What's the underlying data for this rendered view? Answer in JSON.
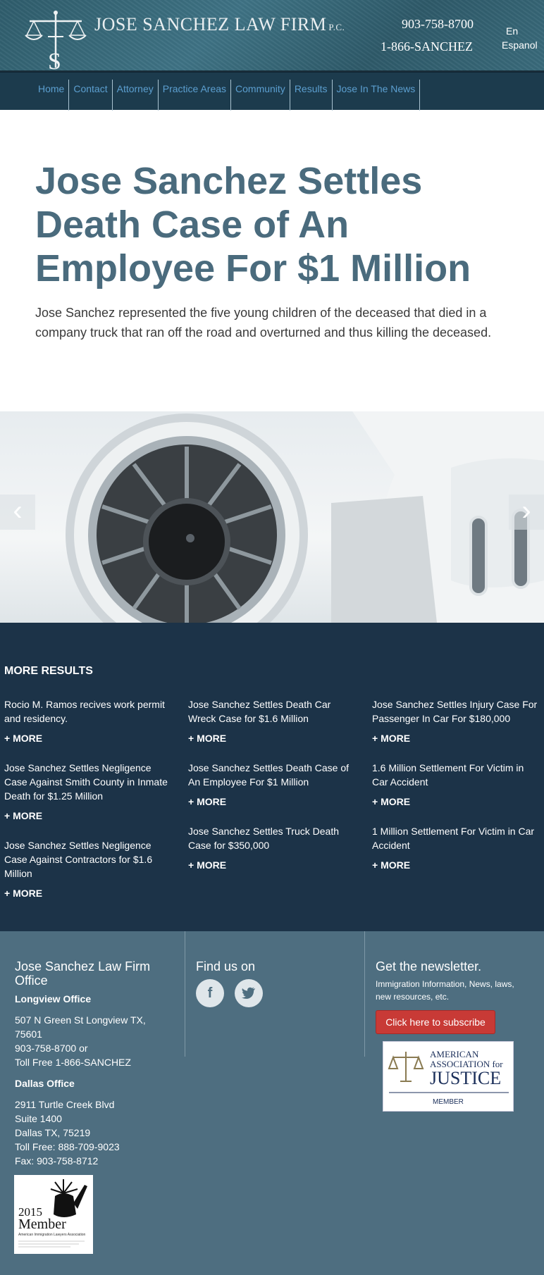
{
  "header": {
    "firm_name": "JOSE SANCHEZ LAW FIRM",
    "firm_suffix": "P.C.",
    "logo_letter": "S",
    "phone_1": "903-758-8700",
    "phone_2": "1-866-SANCHEZ",
    "lang_en": "En",
    "lang_es": "Espanol"
  },
  "nav": {
    "items": [
      "Home",
      "Contact",
      "Attorney",
      "Practice Areas",
      "Community",
      "Results",
      "Jose In The News"
    ]
  },
  "hero": {
    "title": "Jose Sanchez Settles Death Case of An Employee For $1 Million",
    "subtitle": "Jose Sanchez represented the five young children of the deceased that died in a company truck that ran off the road and overturned and thus killing the deceased."
  },
  "slider": {
    "prev_icon": "chevron-left-icon",
    "next_icon": "chevron-right-icon"
  },
  "results": {
    "heading": "MORE RESULTS",
    "more_label": "+ MORE",
    "col1": [
      "Rocio M. Ramos recives work permit and residency.",
      "Jose Sanchez Settles Negligence Case Against Smith County in Inmate Death for $1.25 Million",
      "Jose Sanchez Settles Negligence Case Against Contractors for $1.6 Million"
    ],
    "col2": [
      "Jose Sanchez Settles Death Car Wreck Case for $1.6 Million",
      "Jose Sanchez Settles Death Case of An Employee For $1 Million",
      "Jose Sanchez Settles Truck Death Case for $350,000"
    ],
    "col3": [
      "Jose Sanchez Settles Injury Case For Passenger In Car For $180,000",
      "1.6 Million Settlement For Victim in Car Accident",
      "1 Million Settlement For Victim in Car Accident"
    ]
  },
  "footer": {
    "office_title": "Jose Sanchez Law Firm Office",
    "longview_title": "Longview Office",
    "longview_addr_1": "507 N Green St Longview TX, 75601",
    "longview_phone": "903-758-8700 or",
    "longview_toll": "Toll Free 1-866-SANCHEZ",
    "dallas_title": "Dallas Office",
    "dallas_addr_1": "2911 Turtle Creek Blvd",
    "dallas_addr_2": "Suite 1400",
    "dallas_addr_3": "Dallas TX, 75219",
    "dallas_toll": "Toll Free: 888-709-9023",
    "dallas_fax": "Fax: 903-758-8712",
    "find_us": "Find us on",
    "facebook_icon": "facebook-icon",
    "twitter_icon": "twitter-icon",
    "newsletter_title": "Get the newsletter.",
    "newsletter_desc": "Immigration Information, News, laws, new resources, etc.",
    "subscribe_label": "Click here to subscribe",
    "aaj_line1": "AMERICAN",
    "aaj_line2": "ASSOCIATION for",
    "aaj_line3": "JUSTICE",
    "aaj_member": "MEMBER",
    "aila_year": "2015",
    "aila_member": "Member",
    "aila_org": "American Immigration Lawyers Association"
  }
}
